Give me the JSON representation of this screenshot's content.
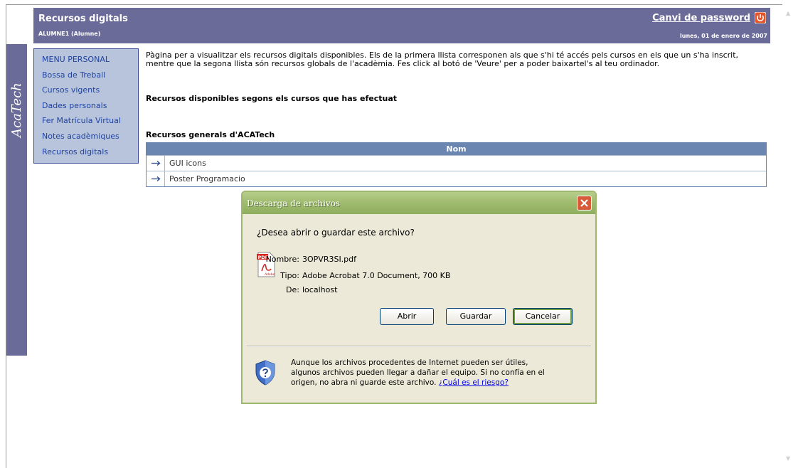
{
  "header": {
    "title": "Recursos digitals",
    "user": "ALUMNE1 (Alumne)",
    "password_link": "Canvi de password",
    "date": "lunes, 01 de enero de 2007"
  },
  "brand": {
    "logo_text": "AcaTech"
  },
  "menu": {
    "items": [
      "MENU PERSONAL",
      "Bossa de Treball",
      "Cursos vigents",
      "Dades personals",
      "Fer Matrícula Virtual",
      "Notes acadèmiques",
      "Recursos digitals"
    ]
  },
  "content": {
    "intro": "Pàgina per a visualitzar els recursos digitals disponibles. Els de la primera llista corresponen als que s'hi té accés pels cursos en els que un s'ha inscrit, mentre que la segona llista són recursos globals de l'acadèmia. Fes click al botó de 'Veure' per a poder baixartel's al teu ordinador.",
    "section_courses": "Recursos disponibles segons els cursos que has efectuat",
    "section_general": "Recursos generals d'ACATech",
    "table_header": "Nom",
    "resources": [
      "GUI icons",
      "Poster Programacio"
    ]
  },
  "dialog": {
    "title": "Descarga de archivos",
    "question": "¿Desea abrir o guardar este archivo?",
    "name_label": "Nombre:",
    "name_value": "3OPVR3SI.pdf",
    "type_label": "Tipo:",
    "type_value": "Adobe Acrobat 7.0 Document, 700 KB",
    "from_label": "De:",
    "from_value": "localhost",
    "open_button": "Abrir",
    "save_button": "Guardar",
    "cancel_button": "Cancelar",
    "warning_text": "Aunque los archivos procedentes de Internet pueden ser útiles, algunos archivos pueden llegar a dañar el equipo. Si no confía en el origen, no abra ni guarde este archivo.",
    "risk_link": "¿Cuál es el riesgo?",
    "pdf_icon_label": "PDF",
    "pdf_icon_caption": "Adobe"
  },
  "colors": {
    "header_bg": "#6b6b99",
    "menu_bg": "#b8c4dc",
    "table_header_bg": "#6b86b0",
    "dialog_titlebar": "#9fbb6e",
    "dialog_body": "#ece9d8"
  },
  "icons": {
    "power": "power-icon",
    "row_arrow": "arrow-right-icon",
    "pdf": "pdf-file-icon",
    "shield": "security-shield-icon",
    "close": "close-icon"
  }
}
